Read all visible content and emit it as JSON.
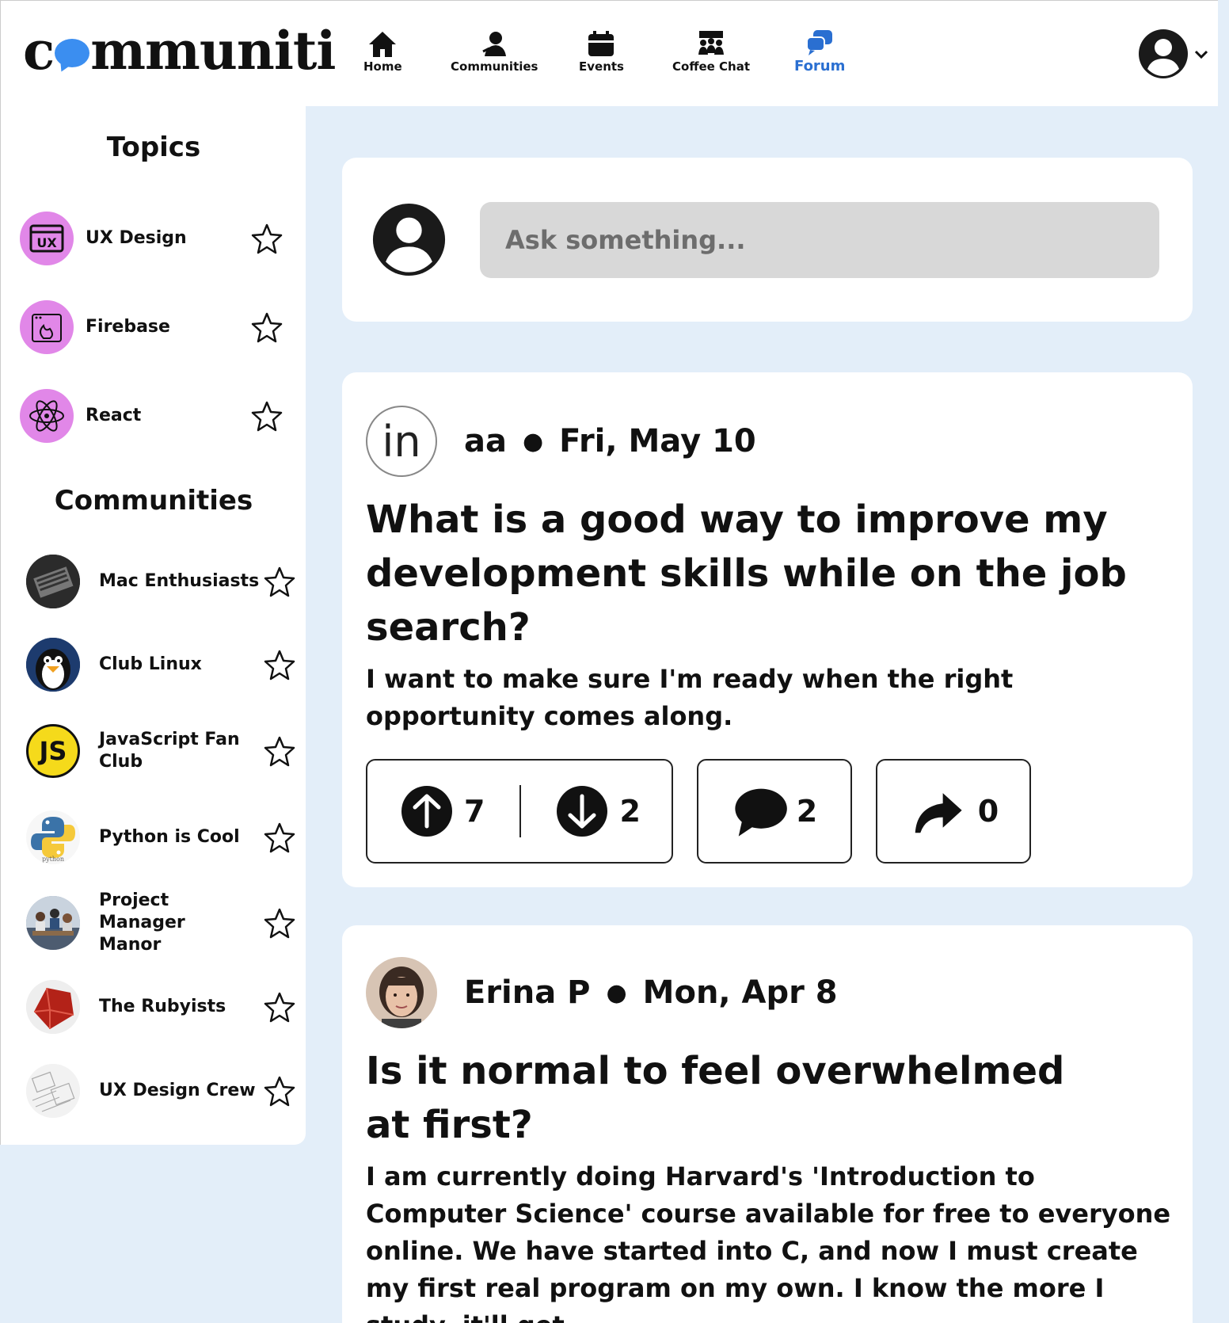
{
  "app": {
    "logo_left": "c",
    "logo_right": "mmuniti"
  },
  "nav": [
    {
      "label": "Home",
      "icon": "home-icon"
    },
    {
      "label": "Communities",
      "icon": "person-icon"
    },
    {
      "label": "Events",
      "icon": "calendar-icon"
    },
    {
      "label": "Coffee Chat",
      "icon": "group-icon"
    },
    {
      "label": "Forum",
      "icon": "chat-bubbles-icon",
      "active": true
    }
  ],
  "colors": {
    "accent": "#2a6fd1",
    "logo_bubble": "#3b8ef0",
    "background": "#e3eef9",
    "topic_icon_bg": "#e187e8",
    "js_yellow": "#f5da1b"
  },
  "sidebar": {
    "topics_heading": "Topics",
    "topics": [
      {
        "label": "UX Design",
        "icon": "ux-icon"
      },
      {
        "label": "Firebase",
        "icon": "firebase-icon"
      },
      {
        "label": "React",
        "icon": "react-icon"
      }
    ],
    "communities_heading": "Communities",
    "communities": [
      {
        "label": "Mac Enthusiasts",
        "icon": "laptop-icon"
      },
      {
        "label": "Club Linux",
        "icon": "penguin-icon"
      },
      {
        "label": "JavaScript Fan Club",
        "icon": "js-icon",
        "icon_text": "JS"
      },
      {
        "label": "Python is Cool",
        "icon": "python-icon",
        "icon_text": "python"
      },
      {
        "label": "Project Manager Manor",
        "icon": "team-photo-icon"
      },
      {
        "label": "The Rubyists",
        "icon": "ruby-icon"
      },
      {
        "label": "UX Design Crew",
        "icon": "wireframe-icon"
      }
    ]
  },
  "composer": {
    "placeholder": "Ask something..."
  },
  "posts": [
    {
      "author": "aa",
      "date": "Fri, May 10",
      "avatar_text": "in",
      "title": "What is a good way to improve my development skills while on the job search?",
      "body": "I want to make sure I'm ready when the right opportunity comes along.",
      "upvotes": "7",
      "downvotes": "2",
      "comments": "2",
      "shares": "0"
    },
    {
      "author": "Erina P",
      "date": "Mon, Apr 8",
      "title": "Is it normal to feel overwhelmed at first?",
      "body": "I am currently doing Harvard's 'Introduction to Computer Science' course available for free to everyone online. We have started into C, and now I must create my first real program on my own. I know the more I study, it'll get"
    }
  ]
}
